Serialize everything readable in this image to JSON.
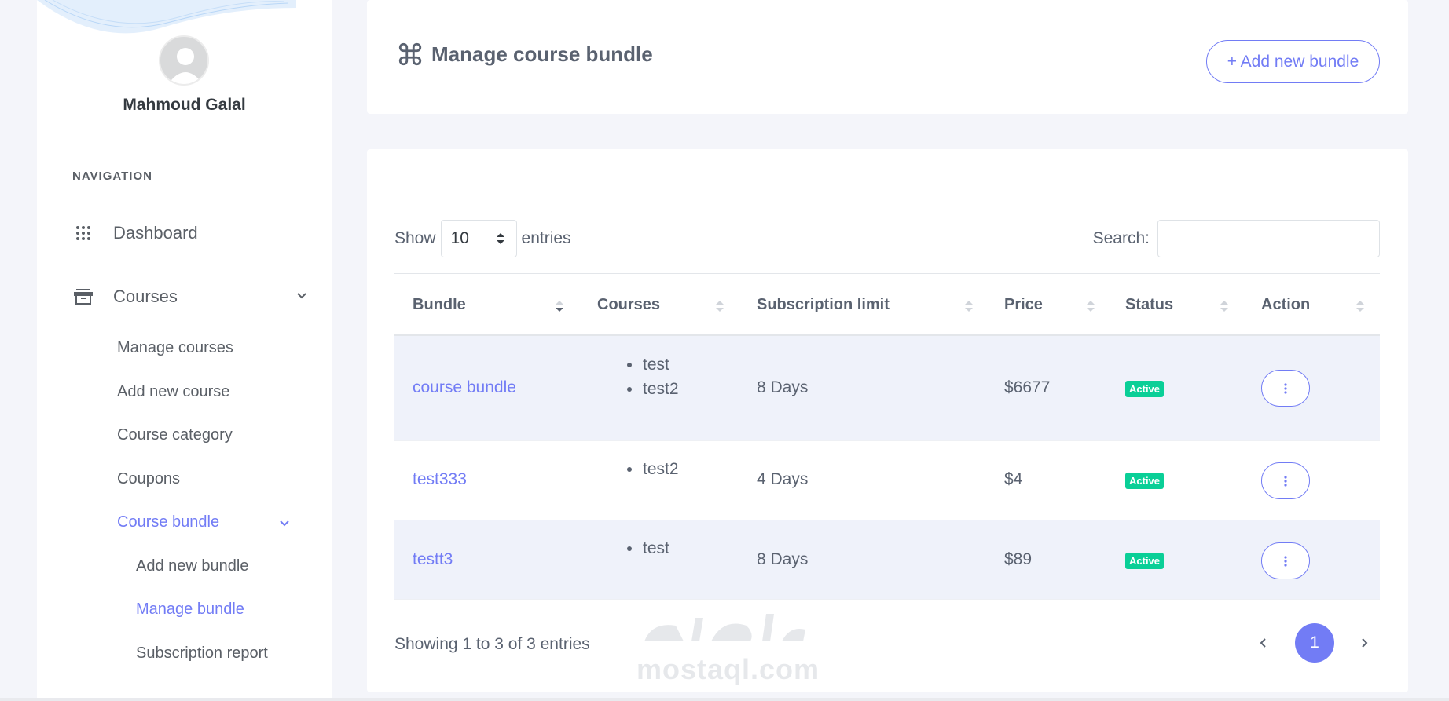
{
  "user": {
    "name": "Mahmoud Galal"
  },
  "nav": {
    "heading": "NAVIGATION",
    "dashboard": "Dashboard",
    "courses": "Courses",
    "courses_sub": [
      "Manage courses",
      "Add new course",
      "Course category",
      "Coupons"
    ],
    "course_bundle": "Course bundle",
    "bundle_sub": [
      "Add new bundle",
      "Manage bundle",
      "Subscription report"
    ]
  },
  "header": {
    "title": "Manage course bundle",
    "add_button": "+ Add new bundle"
  },
  "table_controls": {
    "show_label": "Show",
    "entries_value": "10",
    "entries_label": "entries",
    "search_label": "Search:",
    "search_placeholder": ""
  },
  "table": {
    "columns": [
      "Bundle",
      "Courses",
      "Subscription limit",
      "Price",
      "Status",
      "Action"
    ],
    "rows": [
      {
        "bundle": "course bundle",
        "courses": [
          "test",
          "test2"
        ],
        "limit": "8 Days",
        "price": "$6677",
        "status": "Active"
      },
      {
        "bundle": "test333",
        "courses": [
          "test2"
        ],
        "limit": "4 Days",
        "price": "$4",
        "status": "Active"
      },
      {
        "bundle": "testt3",
        "courses": [
          "test"
        ],
        "limit": "8 Days",
        "price": "$89",
        "status": "Active"
      }
    ]
  },
  "footer": {
    "info": "Showing 1 to 3 of 3 entries",
    "page": "1"
  },
  "watermark": {
    "text": "mostaql.com"
  },
  "colors": {
    "accent": "#727cf5",
    "success": "#0acf97",
    "stripe": "#eff2fa"
  }
}
